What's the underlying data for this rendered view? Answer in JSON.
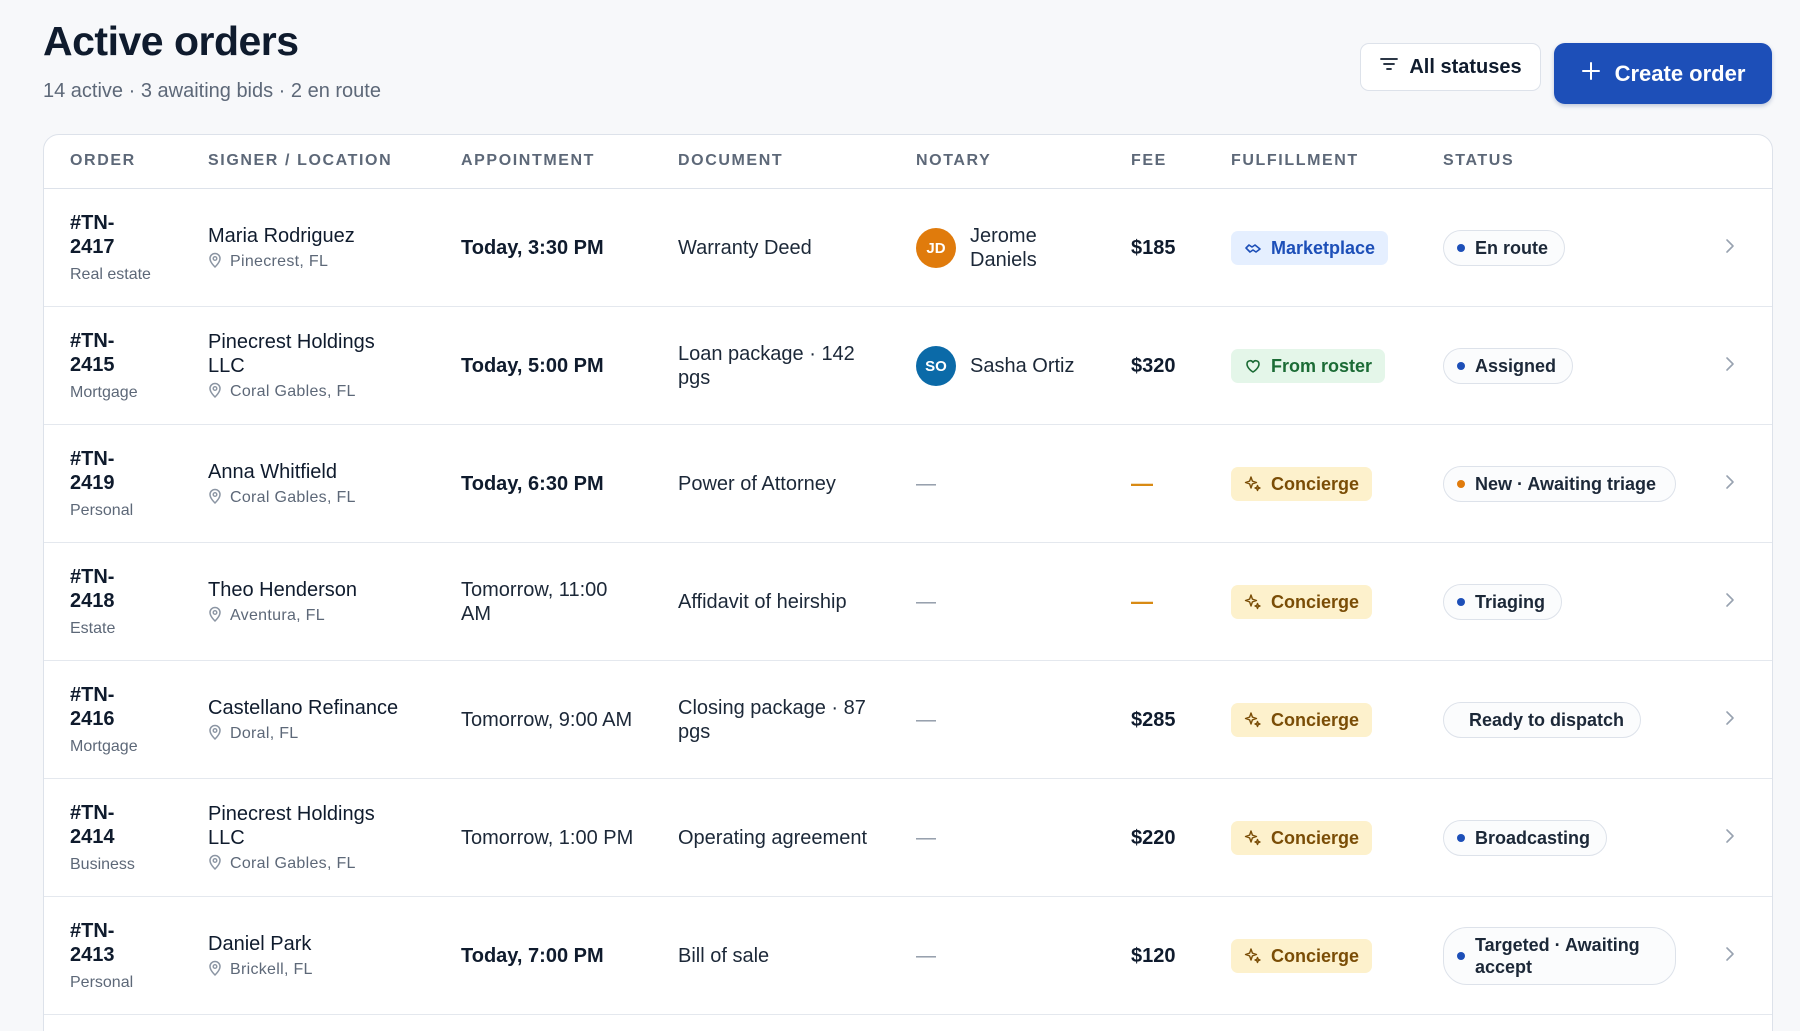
{
  "header": {
    "title": "Active orders",
    "subtitle": "14 active · 3 awaiting bids · 2 en route",
    "filter_label": "All statuses",
    "create_label": "Create order"
  },
  "columns": [
    "ORDER",
    "SIGNER / LOCATION",
    "APPOINTMENT",
    "DOCUMENT",
    "NOTARY",
    "FEE",
    "FULFILLMENT",
    "STATUS"
  ],
  "orders": [
    {
      "id": "#TN-2417",
      "type": "Real estate",
      "signer": "Maria Rodriguez",
      "location": "Pinecrest, FL",
      "appointment": "Today, 3:30 PM",
      "appointment_emphasis": true,
      "document": "Warranty Deed",
      "notary": {
        "initials": "JD",
        "name": "Jerome Daniels",
        "avatar_color": "#e07b0c"
      },
      "fee": "$185",
      "fulfillment": {
        "label": "Marketplace",
        "icon": "handshake-icon"
      },
      "status": {
        "label": "En route",
        "dot_color": "#1d4fb8"
      }
    },
    {
      "id": "#TN-2415",
      "type": "Mortgage",
      "signer": "Pinecrest Holdings LLC",
      "location": "Coral Gables, FL",
      "appointment": "Today, 5:00 PM",
      "appointment_emphasis": true,
      "document": "Loan package · 142 pgs",
      "notary": {
        "initials": "SO",
        "name": "Sasha Ortiz",
        "avatar_color": "#0b6aa8"
      },
      "fee": "$320",
      "fulfillment": {
        "label": "From roster",
        "icon": "heart-icon"
      },
      "status": {
        "label": "Assigned",
        "dot_color": "#1d4fb8"
      }
    },
    {
      "id": "#TN-2419",
      "type": "Personal",
      "signer": "Anna Whitfield",
      "location": "Coral Gables, FL",
      "appointment": "Today, 6:30 PM",
      "appointment_emphasis": true,
      "document": "Power of Attorney",
      "notary": null,
      "notary_placeholder": "—",
      "fee": "—",
      "fee_missing": true,
      "fulfillment": {
        "label": "Concierge",
        "icon": "sparkle-icon"
      },
      "status": {
        "label": "New · Awaiting triage",
        "dot_color": "#e07b0c"
      }
    },
    {
      "id": "#TN-2418",
      "type": "Estate",
      "signer": "Theo Henderson",
      "location": "Aventura, FL",
      "appointment": "Tomorrow, 11:00 AM",
      "appointment_emphasis": false,
      "document": "Affidavit of heirship",
      "notary": null,
      "notary_placeholder": "—",
      "fee": "—",
      "fee_missing": true,
      "fulfillment": {
        "label": "Concierge",
        "icon": "sparkle-icon"
      },
      "status": {
        "label": "Triaging",
        "dot_color": "#1d4fb8"
      }
    },
    {
      "id": "#TN-2416",
      "type": "Mortgage",
      "signer": "Castellano Refinance",
      "location": "Doral, FL",
      "appointment": "Tomorrow, 9:00 AM",
      "appointment_emphasis": false,
      "document": "Closing package · 87 pgs",
      "notary": null,
      "notary_placeholder": "—",
      "fee": "$285",
      "fulfillment": {
        "label": "Concierge",
        "icon": "sparkle-icon"
      },
      "status": {
        "label": "Ready to dispatch",
        "dot_color": ""
      }
    },
    {
      "id": "#TN-2414",
      "type": "Business",
      "signer": "Pinecrest Holdings LLC",
      "location": "Coral Gables, FL",
      "appointment": "Tomorrow, 1:00 PM",
      "appointment_emphasis": false,
      "document": "Operating agreement",
      "notary": null,
      "notary_placeholder": "—",
      "fee": "$220",
      "fulfillment": {
        "label": "Concierge",
        "icon": "sparkle-icon"
      },
      "status": {
        "label": "Broadcasting",
        "dot_color": "#1d4fb8"
      }
    },
    {
      "id": "#TN-2413",
      "type": "Personal",
      "signer": "Daniel Park",
      "location": "Brickell, FL",
      "appointment": "Today, 7:00 PM",
      "appointment_emphasis": true,
      "document": "Bill of sale",
      "notary": null,
      "notary_placeholder": "—",
      "fee": "$120",
      "fulfillment": {
        "label": "Concierge",
        "icon": "sparkle-icon"
      },
      "status": {
        "label": "Targeted · Awaiting accept",
        "dot_color": "#1d4fb8"
      }
    }
  ],
  "colors": {
    "accent": "#1d4fb8",
    "marketplace_bg": "#e5efff",
    "marketplace_fg": "#1d4fb8",
    "roster_bg": "#e4f6e9",
    "roster_fg": "#1b6b35",
    "concierge_bg": "#fdf1cc",
    "concierge_fg": "#7a4d06"
  }
}
